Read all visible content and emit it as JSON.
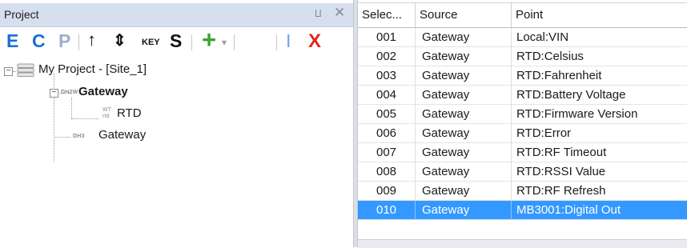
{
  "panel": {
    "title": "Project",
    "pin_glyph": "⨿",
    "close_glyph": "✕"
  },
  "toolbar": {
    "e_label": "E",
    "c_label": "C",
    "p_label": "P",
    "up_glyph": "↑",
    "updown_glyph": "⇕",
    "key_label": "KEY",
    "s_label": "S",
    "add_glyph": "+",
    "dropdown_glyph": "▾",
    "cursor_label": "I",
    "delete_label": "X",
    "colors": {
      "blue": "#1c6fd6",
      "green": "#3aa435",
      "red": "#e0261b",
      "grey": "#9bb0cc"
    }
  },
  "tree": {
    "root": {
      "label": "My Project - [Site_1]",
      "expander": "−"
    },
    "gateway1": {
      "tag": "DH2W",
      "label": "Gateway",
      "expander": "−"
    },
    "rtd": {
      "tag_top": "WT",
      "tag_bottom": "rtd",
      "label": "RTD"
    },
    "gateway2": {
      "tag": "DH3",
      "label": "Gateway"
    }
  },
  "grid": {
    "columns": [
      "Selec...",
      "Source",
      "Point"
    ],
    "rows": [
      {
        "sel": "001",
        "source": "Gateway",
        "point": "Local:VIN"
      },
      {
        "sel": "002",
        "source": "Gateway",
        "point": "RTD:Celsius"
      },
      {
        "sel": "003",
        "source": "Gateway",
        "point": "RTD:Fahrenheit"
      },
      {
        "sel": "004",
        "source": "Gateway",
        "point": "RTD:Battery Voltage"
      },
      {
        "sel": "005",
        "source": "Gateway",
        "point": "RTD:Firmware Version"
      },
      {
        "sel": "006",
        "source": "Gateway",
        "point": "RTD:Error"
      },
      {
        "sel": "007",
        "source": "Gateway",
        "point": "RTD:RF Timeout"
      },
      {
        "sel": "008",
        "source": "Gateway",
        "point": "RTD:RSSI Value"
      },
      {
        "sel": "009",
        "source": "Gateway",
        "point": "RTD:RF Refresh"
      },
      {
        "sel": "010",
        "source": "Gateway",
        "point": "MB3001:Digital Out"
      }
    ],
    "selected_row": 9,
    "selection_color": "#3399ff"
  }
}
